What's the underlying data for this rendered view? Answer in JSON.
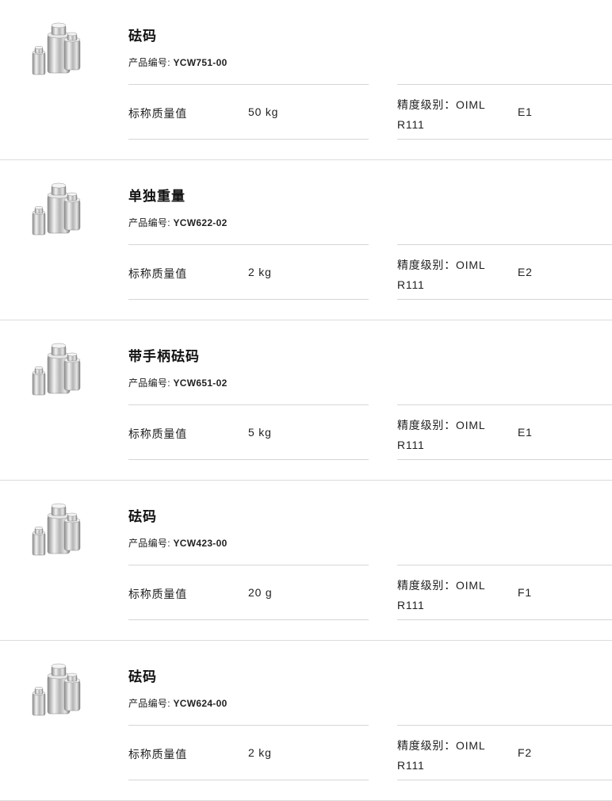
{
  "code_prefix": "产品编号:",
  "mass_label": "标称质量值",
  "accuracy_label": "精度级别：OIML R111",
  "icon": "weights-set-icon",
  "products": [
    {
      "title": "砝码",
      "code": "YCW751-00",
      "mass": "50 kg",
      "accuracy_class": "E1"
    },
    {
      "title": "单独重量",
      "code": "YCW622-02",
      "mass": "2 kg",
      "accuracy_class": "E2"
    },
    {
      "title": "带手柄砝码",
      "code": "YCW651-02",
      "mass": "5 kg",
      "accuracy_class": "E1"
    },
    {
      "title": "砝码",
      "code": "YCW423-00",
      "mass": "20 g",
      "accuracy_class": "F1"
    },
    {
      "title": "砝码",
      "code": "YCW624-00",
      "mass": "2 kg",
      "accuracy_class": "F2"
    }
  ]
}
